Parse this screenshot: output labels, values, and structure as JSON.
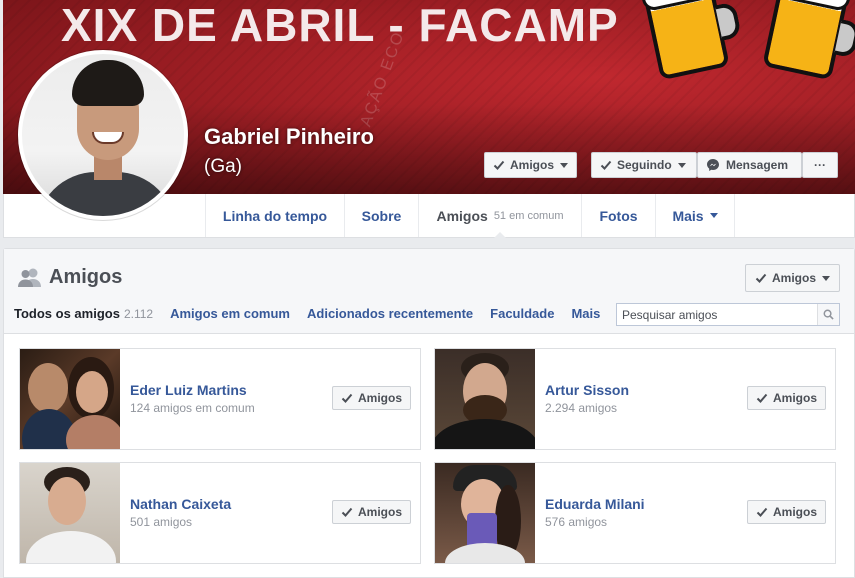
{
  "cover": {
    "title": "XIX DE ABRIL - FACAMP",
    "watermark": "AÇÃO ECO"
  },
  "profile": {
    "name": "Gabriel Pinheiro",
    "alternate_name": "(Ga)"
  },
  "cover_actions": {
    "friends_label": "Amigos",
    "following_label": "Seguindo",
    "message_label": "Mensagem",
    "more_label": "···"
  },
  "nav": {
    "timeline": "Linha do tempo",
    "about": "Sobre",
    "friends": "Amigos",
    "friends_mutual": "51 em comum",
    "photos": "Fotos",
    "more": "Mais"
  },
  "friends_section": {
    "title": "Amigos",
    "header_button": "Amigos",
    "tabs": [
      {
        "label": "Todos os amigos",
        "count": "2.112"
      },
      {
        "label": "Amigos em comum"
      },
      {
        "label": "Adicionados recentemente"
      },
      {
        "label": "Faculdade"
      },
      {
        "label": "Mais"
      }
    ],
    "search_placeholder": "Pesquisar amigos",
    "cards": [
      {
        "name": "Eder Luiz Martins",
        "subtitle": "124 amigos em comum",
        "button": "Amigos"
      },
      {
        "name": "Artur Sisson",
        "subtitle": "2.294 amigos",
        "button": "Amigos"
      },
      {
        "name": "Nathan Caixeta",
        "subtitle": "501 amigos",
        "button": "Amigos"
      },
      {
        "name": "Eduarda Milani",
        "subtitle": "576 amigos",
        "button": "Amigos"
      }
    ]
  },
  "colors": {
    "link": "#365899",
    "cover_red": "#9e1e24",
    "page_bg": "#e9ebee"
  }
}
